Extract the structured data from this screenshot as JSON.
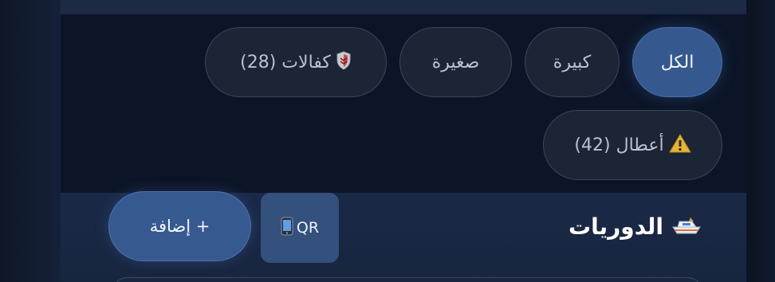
{
  "filters": {
    "all": "الكل",
    "large": "كبيرة",
    "small": "صغيرة",
    "warranties": {
      "icon": "shield-icon",
      "label": "كفالات (28)"
    },
    "faults": {
      "icon": "warning-icon",
      "label": "أعطال (42)"
    }
  },
  "section": {
    "title": "الدوريات",
    "icon": "boat-icon",
    "qr_label": "QR",
    "qr_icon": "phone-icon",
    "add_label": "+ إضافة"
  },
  "colors": {
    "accent": "#35588f",
    "chip_bg": "#1c2536",
    "panel_bg": "#0c1527"
  }
}
